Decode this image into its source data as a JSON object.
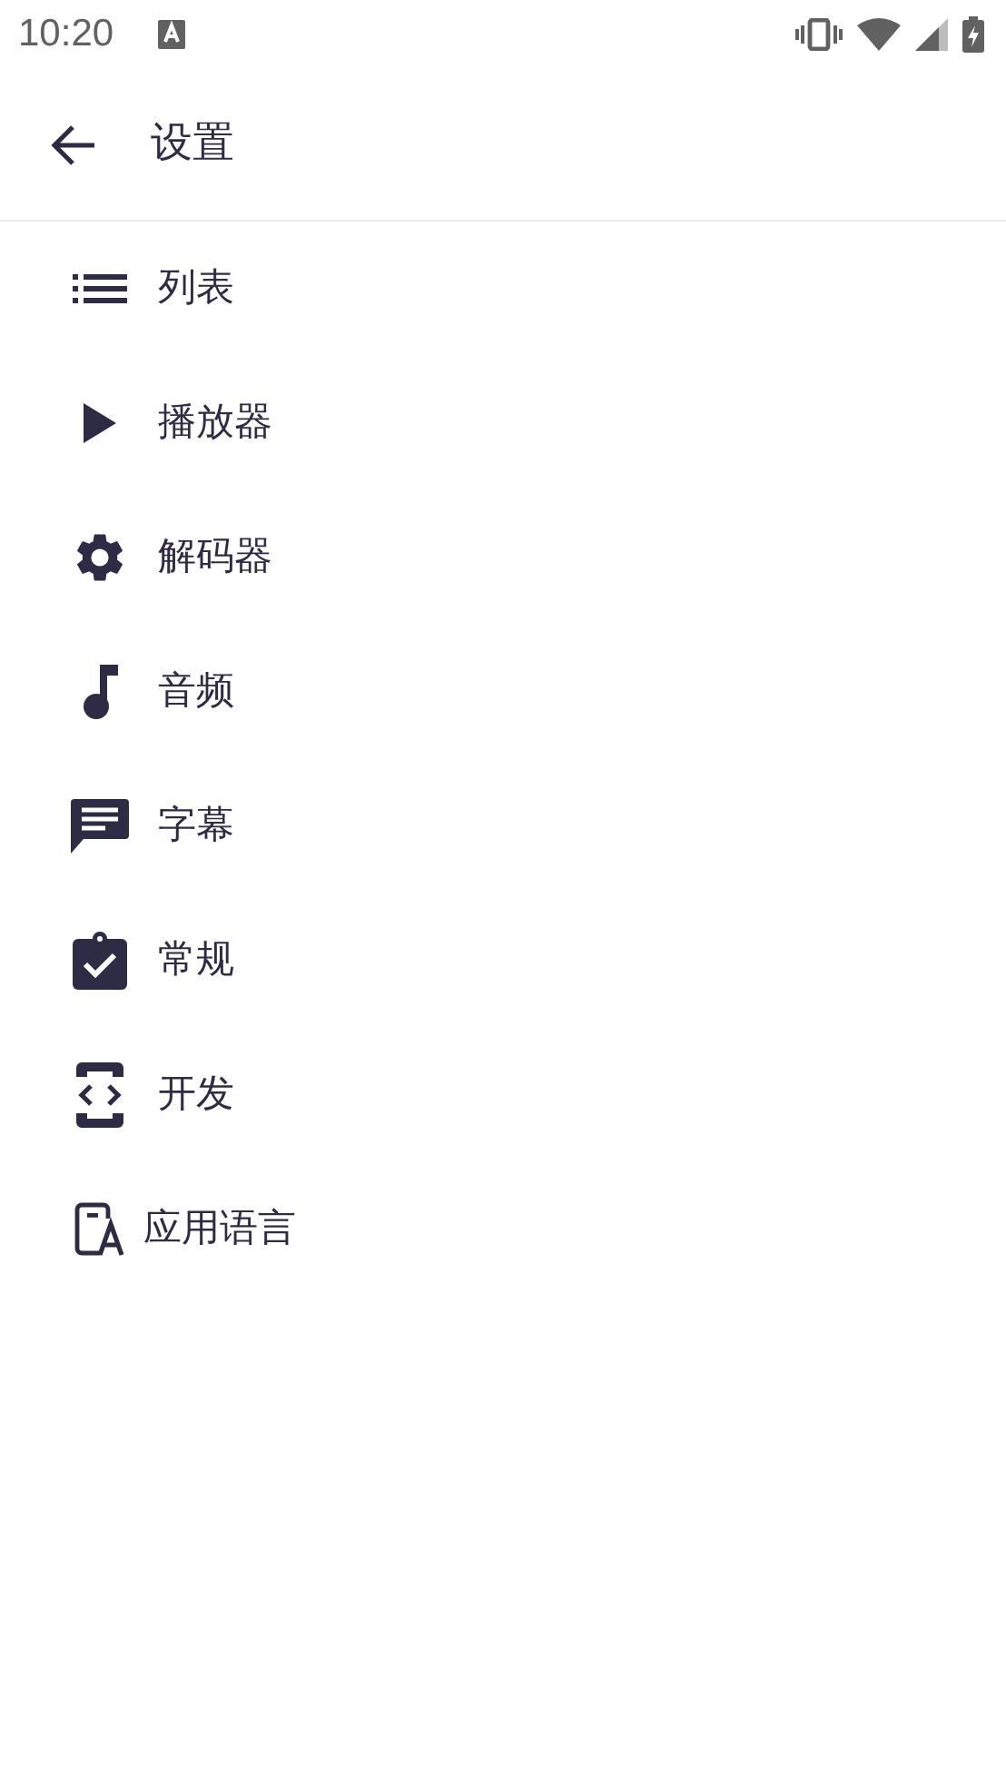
{
  "status_bar": {
    "time": "10:20"
  },
  "app_bar": {
    "title": "设置"
  },
  "items": [
    {
      "label": "列表",
      "kind": "list"
    },
    {
      "label": "播放器",
      "kind": "player"
    },
    {
      "label": "解码器",
      "kind": "decoder"
    },
    {
      "label": "音频",
      "kind": "audio"
    },
    {
      "label": "字幕",
      "kind": "subtitle"
    },
    {
      "label": "常规",
      "kind": "general"
    },
    {
      "label": "开发",
      "kind": "developer"
    },
    {
      "label": "应用语言",
      "kind": "language"
    }
  ]
}
